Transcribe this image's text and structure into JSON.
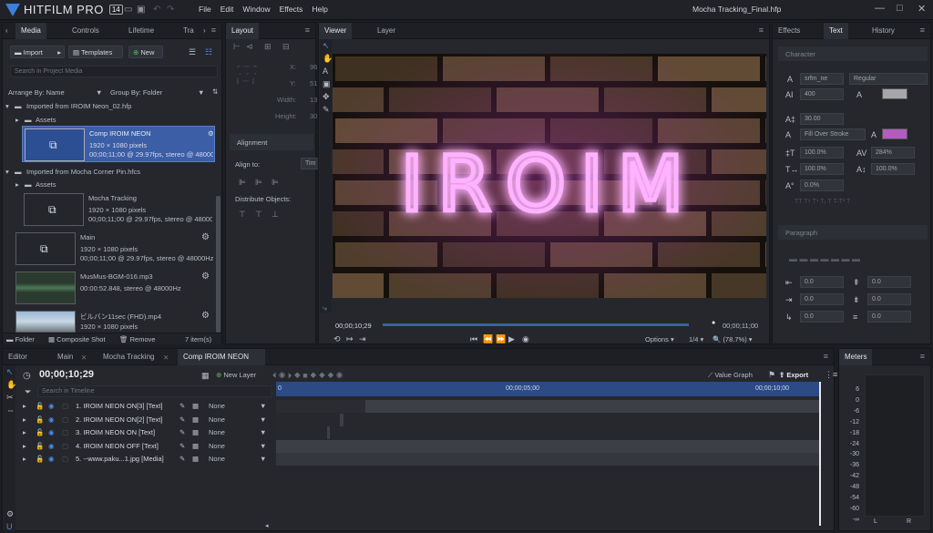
{
  "app": {
    "logo": "HITFILM PRO",
    "version": "14",
    "title": "Mocha Tracking_Final.hfp"
  },
  "menu": [
    "File",
    "Edit",
    "Window",
    "Effects",
    "Help"
  ],
  "media": {
    "tabs": [
      "Media",
      "Controls",
      "Lifetime",
      "Tra"
    ],
    "import": "Import",
    "templates": "Templates",
    "new": "New",
    "search_placeholder": "Search in Project Media",
    "arrange": "Arrange By: Name",
    "group": "Group By: Folder",
    "groups": [
      {
        "label": "Imported from IROIM Neon_02.hfp",
        "assets": "Assets"
      },
      {
        "label": "Imported from Mocha Corner Pin.hfcs",
        "assets": "Assets"
      }
    ],
    "items": [
      {
        "name": "Comp IROIM NEON",
        "line1": "1920 × 1080 pixels",
        "line2": "00;00;11;00 @ 29.97fps, stereo @ 48000H"
      },
      {
        "name": "Mocha Tracking",
        "line1": "1920 × 1080 pixels",
        "line2": "00;00;11;00 @ 29.97fps, stereo @ 48000H"
      },
      {
        "name": "Main",
        "line1": "1920 × 1080 pixels",
        "line2": "00;00;11;00 @ 29.97fps, stereo @ 48000Hz"
      },
      {
        "name": "MusMus-BGM-016.mp3",
        "line1": "00:00:52.848, stereo @ 48000Hz",
        "line2": ""
      },
      {
        "name": "ビルバン11sec (FHD).mp4",
        "line1": "1920 × 1080 pixels",
        "line2": ""
      }
    ],
    "footer": {
      "folder": "Folder",
      "composite": "Composite Shot",
      "remove": "Remove",
      "count": "7 item(s)"
    }
  },
  "layout": {
    "tab": "Layout",
    "x": "X:",
    "y": "Y:",
    "width": "Width:",
    "height": "Height:",
    "xv": "96",
    "yv": "51",
    "wv": "13",
    "hv": "30",
    "alignment": "Alignment",
    "align_to": "Align to:",
    "align_to_val": "Tim",
    "distribute": "Distribute Objects:"
  },
  "viewer": {
    "tabs": [
      "Viewer",
      "Layer"
    ],
    "neon_text": "IROIM",
    "time_current": "00;00;10;29",
    "time_end": "00;00;11;00",
    "options": "Options",
    "fraction": "1/4",
    "zoom": "(78.7%)"
  },
  "text_panel": {
    "tabs": [
      "Effects",
      "Text",
      "History"
    ],
    "character": "Character",
    "font": "srfm_ne",
    "style": "Regular",
    "size": "400",
    "leading": "30.00",
    "fill_mode": "Fill Over Stroke",
    "scale_v": "100.0%",
    "tracking": "284%",
    "scale_h": "100.0%",
    "baseline_pct": "100.0%",
    "shift": "0.0%",
    "paragraph": "Paragraph",
    "indent": [
      "0.0",
      "0.0",
      "0.0",
      "0.0",
      "0.0",
      "0.0"
    ],
    "fill_color": "#a7a7a7",
    "stroke_color": "#b45cc0"
  },
  "editor": {
    "tabs": [
      "Editor",
      "Main",
      "Mocha Tracking",
      "Comp IROIM NEON"
    ],
    "timecode": "00;00;10;29",
    "new_layer": "New Layer",
    "value_graph": "Value Graph",
    "export": "Export",
    "search_placeholder": "Search in Timeline",
    "ruler": [
      "0",
      "00;00;05;00",
      "00;00;10;00"
    ],
    "blend": "None",
    "layers": [
      "1. IROIM NEON ON[3] [Text]",
      "2. IROIM NEON ON[2] [Text]",
      "3. IROIM NEON ON [Text]",
      "4. IROIM NEON OFF [Text]",
      "5. --www.paku...1.jpg [Media]"
    ]
  },
  "meters": {
    "tab": "Meters",
    "scale": [
      "6",
      "0",
      "-6",
      "-12",
      "-18",
      "-24",
      "-30",
      "-36",
      "-42",
      "-48",
      "-54",
      "-60",
      "-∞"
    ],
    "left": "L",
    "right": "R"
  },
  "colors": {
    "accent": "#3d7fd8",
    "neon": "#ff8cff",
    "selection": "#3b5ea6"
  }
}
